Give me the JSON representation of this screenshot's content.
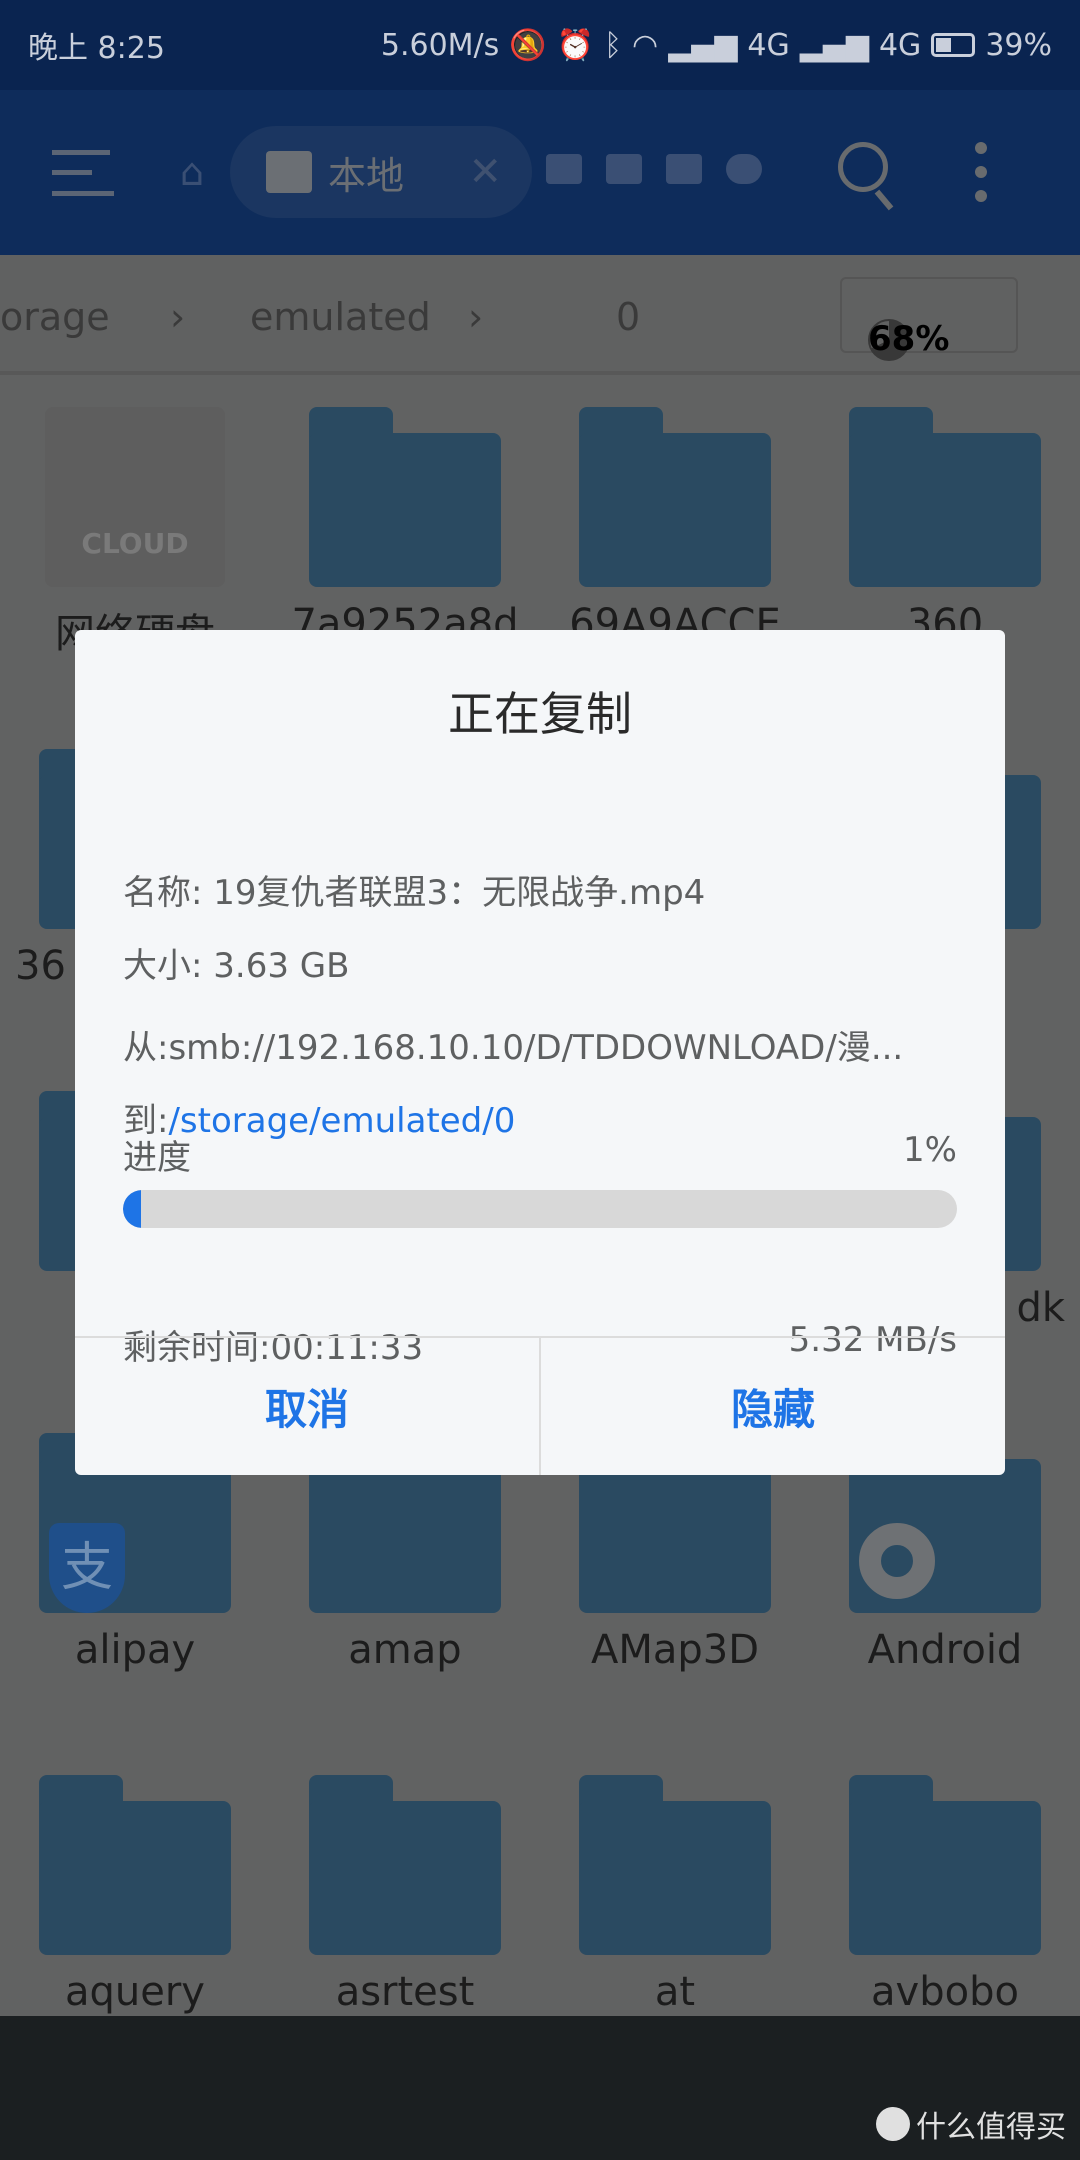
{
  "status_bar": {
    "time": "晚上 8:25",
    "net_speed": "5.60M/s",
    "signal1": "4G",
    "signal2": "4G",
    "battery": "39%",
    "battery_level": 0.39
  },
  "toolbar": {
    "tab_label": "本地",
    "icons": [
      "menu-icon",
      "home-icon",
      "sd-card-icon",
      "close-icon",
      "router-icon",
      "router-icon",
      "sd-card-icon",
      "cloud-icon",
      "search-icon",
      "more-vert-icon"
    ]
  },
  "breadcrumb": {
    "items": [
      "orage",
      "emulated",
      "0"
    ],
    "usage": "68%",
    "usage_value": 68
  },
  "files": [
    {
      "name": "网络硬盘",
      "type": "cloud",
      "badge": "CLOUD"
    },
    {
      "name": "7a9252a8d"
    },
    {
      "name": "69A9ACCE"
    },
    {
      "name": "360"
    },
    {
      "name": "36"
    },
    {
      "name": ""
    },
    {
      "name": ""
    },
    {
      "name": ""
    },
    {
      "name": ""
    },
    {
      "name": ""
    },
    {
      "name": ""
    },
    {
      "name": "dk"
    },
    {
      "name": "alipay",
      "overlay": "alipay",
      "overlay_text": "支"
    },
    {
      "name": "amap"
    },
    {
      "name": "AMap3D"
    },
    {
      "name": "Android",
      "overlay": "gear"
    },
    {
      "name": "aquery"
    },
    {
      "name": "asrtest"
    },
    {
      "name": "at"
    },
    {
      "name": "avbobo"
    }
  ],
  "dialog": {
    "title": "正在复制",
    "name_label": "名称: ",
    "name_value": "19复仇者联盟3：无限战争.mp4",
    "size_label": "大小: ",
    "size_value": "3.63 GB",
    "from_label": "从:",
    "from_value": "smb://192.168.10.10/D/TDDOWNLOAD/漫...",
    "to_label": "到:",
    "to_value": "/storage/emulated/0",
    "progress_label": "进度",
    "progress_text": "1%",
    "progress_value": 1,
    "remaining": "剩余时间:00:11:33",
    "speed": "5.32 MB/s",
    "cancel": "取消",
    "hide": "隐藏"
  },
  "watermark": "什么值得买",
  "colors": {
    "accent": "#1e74e6",
    "folder": "#2a4a61",
    "status_bar": "#0a2450"
  }
}
